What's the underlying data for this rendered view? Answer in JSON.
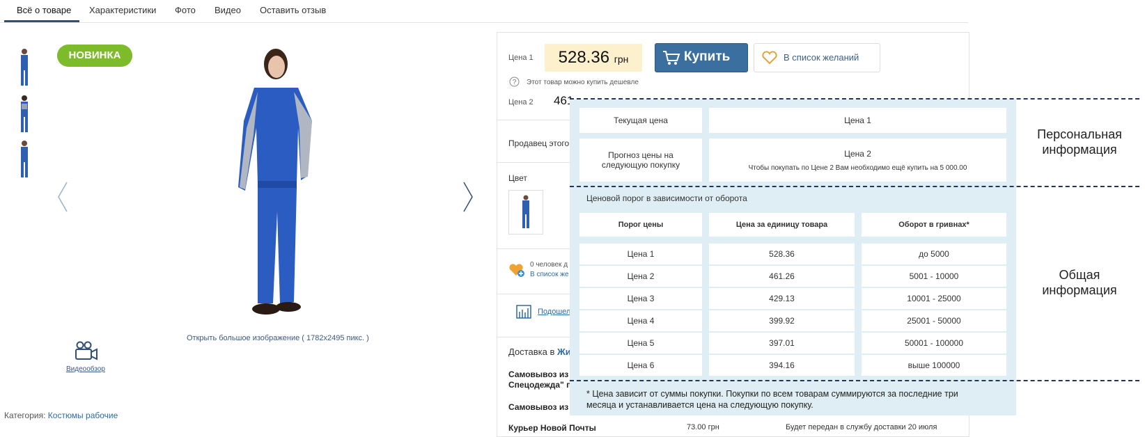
{
  "tabs": [
    {
      "label": "Всё о товаре"
    },
    {
      "label": "Характеристики"
    },
    {
      "label": "Фото"
    },
    {
      "label": "Видео"
    },
    {
      "label": "Оставить отзыв"
    }
  ],
  "gallery": {
    "badge": "НОВИНКА",
    "open_image_link": "Открыть большое изображение",
    "image_size": "( 1782x2495 пикс. )",
    "video_label": "Видеообзор"
  },
  "category": {
    "label": "Категория:",
    "value": "Костюмы рабочие"
  },
  "product": {
    "price1_label": "Цена 1",
    "price1_value": "528.36",
    "currency": "грн",
    "buy_label": "Купить",
    "wishlist_label": "В список желаний",
    "cheaper_note": "Этот товар можно купить дешевле",
    "price2_label": "Цена 2",
    "price2_partial": "461",
    "seller_partial": "Продавец этого",
    "color_label": "Цвет",
    "wish_count_partial": "0 человек д",
    "wish_link_partial": "В список же",
    "share_partial": "Подошел",
    "delivery_label": "Доставка в",
    "delivery_city_partial": "Жи",
    "pickup1_partial": "Самовывоз из",
    "pickup1_line2_partial": "Спецодежда\" п",
    "pickup2_partial": "Самовывоз из",
    "courier_partial": "Курьер Новой Почты",
    "courier_price": "73.00 грн",
    "courier_note_partial": "Будет передан в службу доставки 20 июля"
  },
  "overlay": {
    "personal": {
      "current_price_label": "Текущая цена",
      "current_price_value": "Цена 1",
      "forecast_label_line1": "Прогноз цены на",
      "forecast_label_line2": "следующую покупку",
      "forecast_value": "Цена 2",
      "forecast_note": "Чтобы покупать по Цене 2 Вам необходимо ещё купить на 5 000.00"
    },
    "threshold_title": "Ценовой порог в зависимости от оборота",
    "table": {
      "headers": [
        "Порог цены",
        "Цена за единицу товара",
        "Оборот в гривнах*"
      ],
      "rows": [
        [
          "Цена 1",
          "528.36",
          "до 5000"
        ],
        [
          "Цена 2",
          "461.26",
          "5001 - 10000"
        ],
        [
          "Цена 3",
          "429.13",
          "10001 - 25000"
        ],
        [
          "Цена 4",
          "399.92",
          "25001 - 50000"
        ],
        [
          "Цена 5",
          "397.01",
          "50001 - 100000"
        ],
        [
          "Цена 6",
          "394.16",
          "выше 100000"
        ]
      ]
    },
    "footnote_line1": "* Цена зависит от суммы покупки. Покупки по всем товарам суммируются за последние три",
    "footnote_line2": "месяца и устанавливается цена на следующую покупку."
  },
  "annotations": {
    "personal_line1": "Персональная",
    "personal_line2": "информация",
    "general_line1": "Общая",
    "general_line2": "информация"
  },
  "colors": {
    "accent": "#2f4f74",
    "badge": "#7dbb2a",
    "price_bg": "#fdf1cd",
    "buy_button": "#3a6fa0",
    "overlay_bg": "#deeef4",
    "link": "#2e6aa6"
  }
}
